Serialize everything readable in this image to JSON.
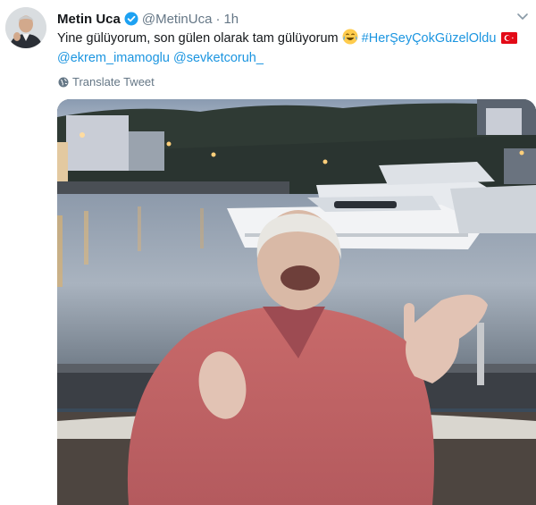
{
  "tweet": {
    "display_name": "Metin Uca",
    "handle": "@MetinUca",
    "separator": "·",
    "time": "1h",
    "text_start": "Yine gülüyorum, son gülen olarak tam gülüyorum",
    "hashtag": "#HerŞeyÇokGüzelOldu",
    "mention_1": "@ekrem_imamoglu",
    "mention_2": "@sevketcoruh_",
    "translate_label": "Translate Tweet"
  },
  "colors": {
    "link": "#1b95e0",
    "secondary": "#657786",
    "verified": "#1da1f2"
  },
  "icons": {
    "verified": "verified-badge-icon",
    "laugh": "tears-of-joy-emoji",
    "flag": "turkey-flag-emoji",
    "globe": "globe-icon",
    "menu": "chevron-down-icon"
  }
}
